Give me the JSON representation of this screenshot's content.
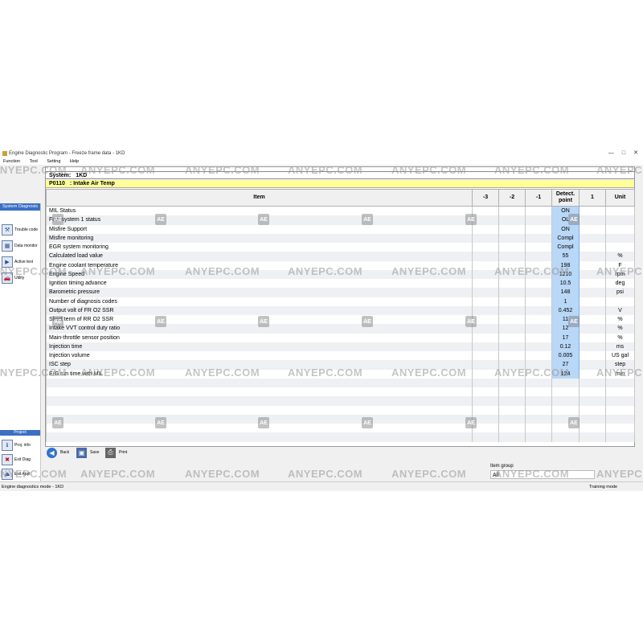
{
  "window": {
    "title": "Engine Diagnostic Program - Freeze frame data - 1KD",
    "menu": [
      "Function",
      "Tool",
      "Setting",
      "Help"
    ],
    "controls": [
      "—",
      "□",
      "✕"
    ]
  },
  "sidebar": {
    "header": "System Diagnosis",
    "items": [
      {
        "label": "Trouble code",
        "icon": "wrench-icon"
      },
      {
        "label": "Data monitor",
        "icon": "monitor-icon"
      },
      {
        "label": "Active test",
        "icon": "active-test-icon"
      },
      {
        "label": "Utility",
        "icon": "car-icon"
      }
    ],
    "project_header": "Project",
    "project_items": [
      {
        "label": "Proj. info",
        "icon": "info-icon"
      },
      {
        "label": "Exit Diag",
        "icon": "exit-icon"
      },
      {
        "label": "Exit Appl",
        "icon": "exit-app-icon"
      }
    ]
  },
  "system": {
    "label": "System:",
    "value": "1KD"
  },
  "dtc": {
    "code": "P0110",
    "description": ": Intake Air Temp"
  },
  "table": {
    "headers": [
      "Item",
      "-3",
      "-2",
      "-1",
      "Detect. point",
      "1",
      "Unit"
    ],
    "rows": [
      {
        "item": "MIL Status",
        "detect": "ON",
        "unit": ""
      },
      {
        "item": "Fuel system 1 status",
        "detect": "OL",
        "unit": ""
      },
      {
        "item": "Misfire Support",
        "detect": "ON",
        "unit": ""
      },
      {
        "item": "Misfire monitoring",
        "detect": "Compl",
        "unit": ""
      },
      {
        "item": "EGR system monitoring",
        "detect": "Compl",
        "unit": ""
      },
      {
        "item": "Calculated load value",
        "detect": "55",
        "unit": "%"
      },
      {
        "item": "Engine coolant temperature",
        "detect": "198",
        "unit": "F"
      },
      {
        "item": "Engine Speed",
        "detect": "1210",
        "unit": "rpm"
      },
      {
        "item": "Ignition timing advance",
        "detect": "10.5",
        "unit": "deg"
      },
      {
        "item": "Barometric pressure",
        "detect": "148",
        "unit": "psi"
      },
      {
        "item": "Number of diagnosis codes",
        "detect": "1",
        "unit": ""
      },
      {
        "item": "Output volt of FR O2 SSR",
        "detect": "0.452",
        "unit": "V"
      },
      {
        "item": "Short term of RR O2 SSR",
        "detect": "11",
        "unit": "%"
      },
      {
        "item": "Intake VVT control duty ratio",
        "detect": "12",
        "unit": "%"
      },
      {
        "item": "Main-throttle sensor position",
        "detect": "17",
        "unit": "%"
      },
      {
        "item": "Injection time",
        "detect": "0.12",
        "unit": "ms"
      },
      {
        "item": "Injection volume",
        "detect": "0.005",
        "unit": "US gal"
      },
      {
        "item": "ISC step",
        "detect": "27",
        "unit": "step"
      },
      {
        "item": "E/G run time with MIL",
        "detect": "124",
        "unit": "min"
      }
    ],
    "empty_rows": 7
  },
  "footer": {
    "back": "Back",
    "save": "Save",
    "print": "Print",
    "item_group_label": "Item group",
    "item_group_value": "All"
  },
  "status": {
    "left": "Engine diagnostics mode  -  1KD",
    "right": "Training mode"
  },
  "watermark": {
    "text": "ANYEPC.COM",
    "logo": "AE"
  },
  "colors": {
    "sidebar_header": "#3a6fc4",
    "dtc_bar": "#ffff99",
    "detect_column": "#b9d7f7"
  }
}
